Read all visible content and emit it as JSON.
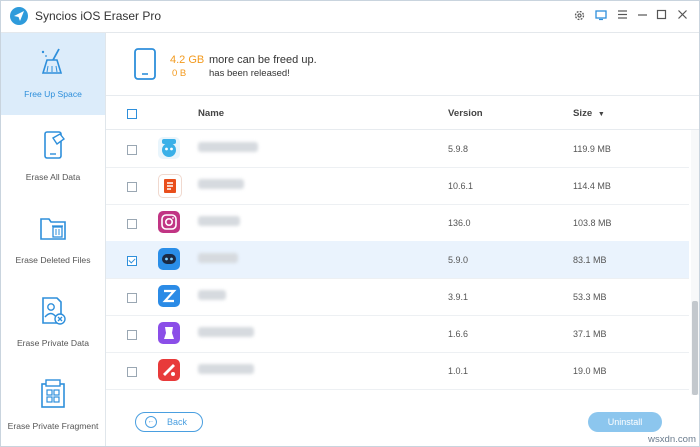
{
  "window": {
    "title": "Syncios iOS Eraser Pro",
    "controls": [
      "gear-icon",
      "display-icon",
      "menu-icon",
      "minimize-icon",
      "maximize-icon",
      "close-icon"
    ]
  },
  "sidebar": {
    "items": [
      {
        "label": "Free Up Space",
        "icon": "broom-icon",
        "active": true
      },
      {
        "label": "Erase All Data",
        "icon": "phone-eraser-icon",
        "active": false
      },
      {
        "label": "Erase Deleted Files",
        "icon": "folder-trash-icon",
        "active": false
      },
      {
        "label": "Erase Private Data",
        "icon": "private-doc-icon",
        "active": false
      },
      {
        "label": "Erase Private Fragment",
        "icon": "fragment-grid-icon",
        "active": false
      }
    ]
  },
  "banner": {
    "freeable_amount": "4.2 GB",
    "freeable_text": "more can be freed up.",
    "released_amount": "0 B",
    "released_text": "has been released!"
  },
  "table": {
    "headers": {
      "name": "Name",
      "version": "Version",
      "size": "Size"
    },
    "sort_indicator": "▼",
    "rows": [
      {
        "version": "5.9.8",
        "size": "119.9 MB",
        "checked": false,
        "icon_color": "#3ab0e8"
      },
      {
        "version": "10.6.1",
        "size": "114.4 MB",
        "checked": false,
        "icon_color": "#e94e1b"
      },
      {
        "version": "136.0",
        "size": "103.8 MB",
        "checked": false,
        "icon_color": "#c13584"
      },
      {
        "version": "5.9.0",
        "size": "83.1 MB",
        "checked": true,
        "icon_color": "#2a8ee8"
      },
      {
        "version": "3.9.1",
        "size": "53.3 MB",
        "checked": false,
        "icon_color": "#2b8be6"
      },
      {
        "version": "1.6.6",
        "size": "37.1 MB",
        "checked": false,
        "icon_color": "#8b4ee8"
      },
      {
        "version": "1.0.1",
        "size": "19.0 MB",
        "checked": false,
        "icon_color": "#e83a3a"
      }
    ]
  },
  "footer": {
    "back_label": "Back",
    "uninstall_label": "Uninstall"
  },
  "watermark": "wsxdn.com",
  "colors": {
    "accent": "#2e8fdb",
    "highlight": "#f39a1e",
    "active_nav_bg": "#dcecfa"
  }
}
